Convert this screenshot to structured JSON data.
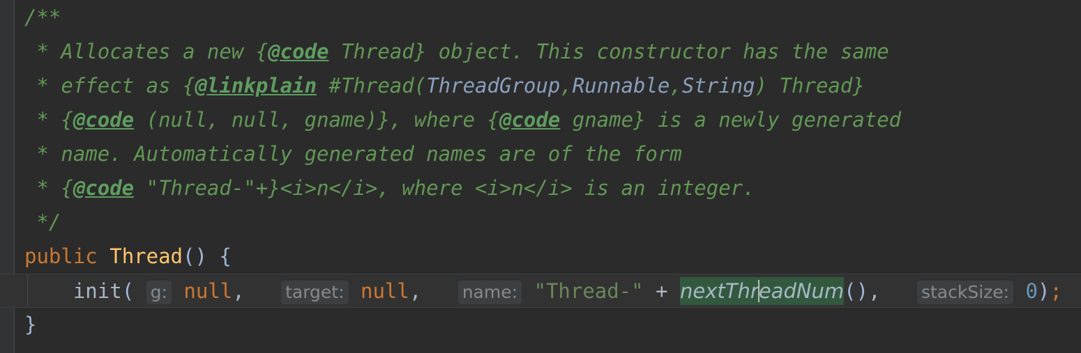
{
  "editor": {
    "theme_name": "darcula",
    "background": "#2b2b2b",
    "gutter_background": "#313335",
    "highlight_line_background": "#323232",
    "usage_highlight_background": "#32593D",
    "colors": {
      "comment": "#629755",
      "javadoc_tag": "#5F9D60",
      "javadoc_ref": "#8A9FBC",
      "keyword": "#CC7832",
      "class_name": "#FFC66D",
      "string": "#6A8759",
      "number": "#6897BB",
      "default_text": "#A9B7C6",
      "inlay_hint_text": "#868A8C",
      "inlay_hint_background": "#3C3F41"
    }
  },
  "lines": [
    {
      "id": "line-comment-open",
      "segments": [
        {
          "kind": "comment",
          "text": "/**"
        }
      ]
    },
    {
      "id": "line-allocates",
      "segments": [
        {
          "kind": "comment",
          "text": " * Allocates a new {"
        },
        {
          "kind": "tag",
          "text": "@code"
        },
        {
          "kind": "comment",
          "text": " Thread} object. This constructor has the same"
        }
      ]
    },
    {
      "id": "line-effect-as",
      "segments": [
        {
          "kind": "comment",
          "text": " * effect as {"
        },
        {
          "kind": "tag",
          "text": "@linkplain"
        },
        {
          "kind": "comment",
          "text": " #Thread("
        },
        {
          "kind": "ref",
          "text": "ThreadGroup"
        },
        {
          "kind": "comment",
          "text": ","
        },
        {
          "kind": "ref",
          "text": "Runnable"
        },
        {
          "kind": "comment",
          "text": ","
        },
        {
          "kind": "ref",
          "text": "String"
        },
        {
          "kind": "comment",
          "text": ") Thread}"
        }
      ]
    },
    {
      "id": "line-code-null",
      "segments": [
        {
          "kind": "comment",
          "text": " * {"
        },
        {
          "kind": "tag",
          "text": "@code"
        },
        {
          "kind": "comment",
          "text": " (null, null, gname)}, where {"
        },
        {
          "kind": "tag",
          "text": "@code"
        },
        {
          "kind": "comment",
          "text": " gname} is a newly generated"
        }
      ]
    },
    {
      "id": "line-name-auto",
      "segments": [
        {
          "kind": "comment",
          "text": " * name. Automatically generated names are of the form"
        }
      ]
    },
    {
      "id": "line-thread-n",
      "segments": [
        {
          "kind": "comment",
          "text": " * {"
        },
        {
          "kind": "tag",
          "text": "@code"
        },
        {
          "kind": "comment",
          "text": " \"Thread-\"+}<i>n</i>, where <i>n</i> is an integer."
        }
      ]
    },
    {
      "id": "line-comment-close",
      "segments": [
        {
          "kind": "comment",
          "text": " */"
        }
      ]
    },
    {
      "id": "line-signature",
      "segments": [
        {
          "kind": "keyword",
          "text": "public"
        },
        {
          "kind": "plain",
          "text": " "
        },
        {
          "kind": "type",
          "text": "Thread"
        },
        {
          "kind": "paren",
          "text": "()"
        },
        {
          "kind": "plain",
          "text": " "
        },
        {
          "kind": "paren",
          "text": "{"
        }
      ]
    },
    {
      "id": "line-init-call",
      "highlighted": true,
      "segments": [
        {
          "kind": "plain",
          "text": "    "
        },
        {
          "kind": "method",
          "text": "init"
        },
        {
          "kind": "paren",
          "text": "("
        },
        {
          "kind": "hint",
          "text": "g:"
        },
        {
          "kind": "keyword",
          "text": "null"
        },
        {
          "kind": "punct",
          "text": ","
        },
        {
          "kind": "plain",
          "text": "  "
        },
        {
          "kind": "hint",
          "text": "target:"
        },
        {
          "kind": "keyword",
          "text": "null"
        },
        {
          "kind": "punct",
          "text": ","
        },
        {
          "kind": "plain",
          "text": "  "
        },
        {
          "kind": "hint",
          "text": "name:"
        },
        {
          "kind": "string",
          "text": "\"Thread-\""
        },
        {
          "kind": "plain",
          "text": " "
        },
        {
          "kind": "punct",
          "text": "+"
        },
        {
          "kind": "plain",
          "text": " "
        },
        {
          "kind": "usage",
          "text": "nextThreadNum",
          "caret_after": "nextThr"
        },
        {
          "kind": "paren",
          "text": "()"
        },
        {
          "kind": "punct",
          "text": ","
        },
        {
          "kind": "plain",
          "text": "  "
        },
        {
          "kind": "hint",
          "text": "stackSize:"
        },
        {
          "kind": "number",
          "text": "0"
        },
        {
          "kind": "paren",
          "text": ")"
        },
        {
          "kind": "semi",
          "text": ";"
        }
      ]
    },
    {
      "id": "line-close-brace",
      "segments": [
        {
          "kind": "paren",
          "text": "}"
        }
      ]
    }
  ]
}
